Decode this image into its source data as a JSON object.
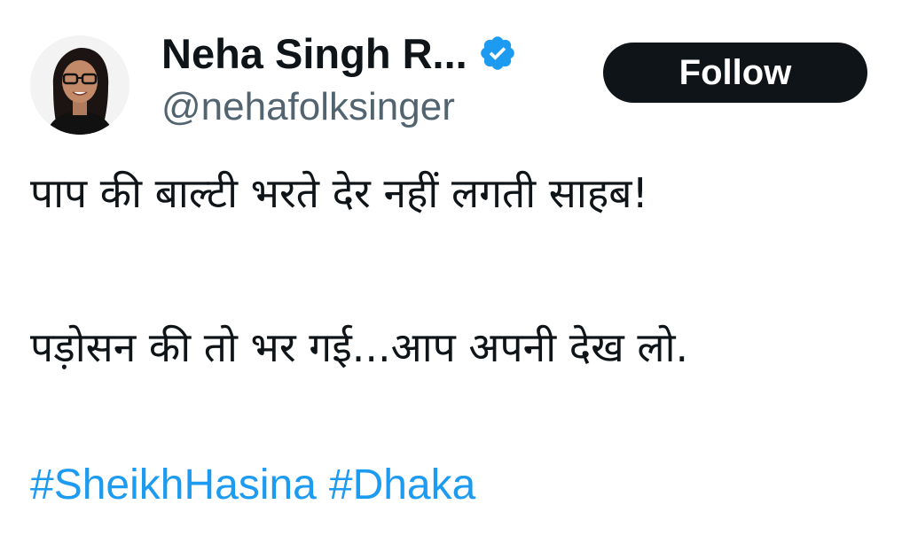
{
  "author": {
    "display_name": "Neha Singh R...",
    "handle": "@nehafolksinger",
    "verified_icon": "verified-badge-icon"
  },
  "follow_button": {
    "label": "Follow"
  },
  "tweet": {
    "lines": [
      "पाप की बाल्टी भरते देर नहीं लगती साहब!",
      "पड़ोसन की तो भर गई...आप अपनी देख लो."
    ],
    "hashtags": [
      "#SheikhHasina",
      "#Dhaka"
    ]
  },
  "colors": {
    "text": "#0f1419",
    "handle": "#536471",
    "link": "#1d9bf0",
    "follow_bg": "#0f1419",
    "verified": "#1d9bf0"
  }
}
